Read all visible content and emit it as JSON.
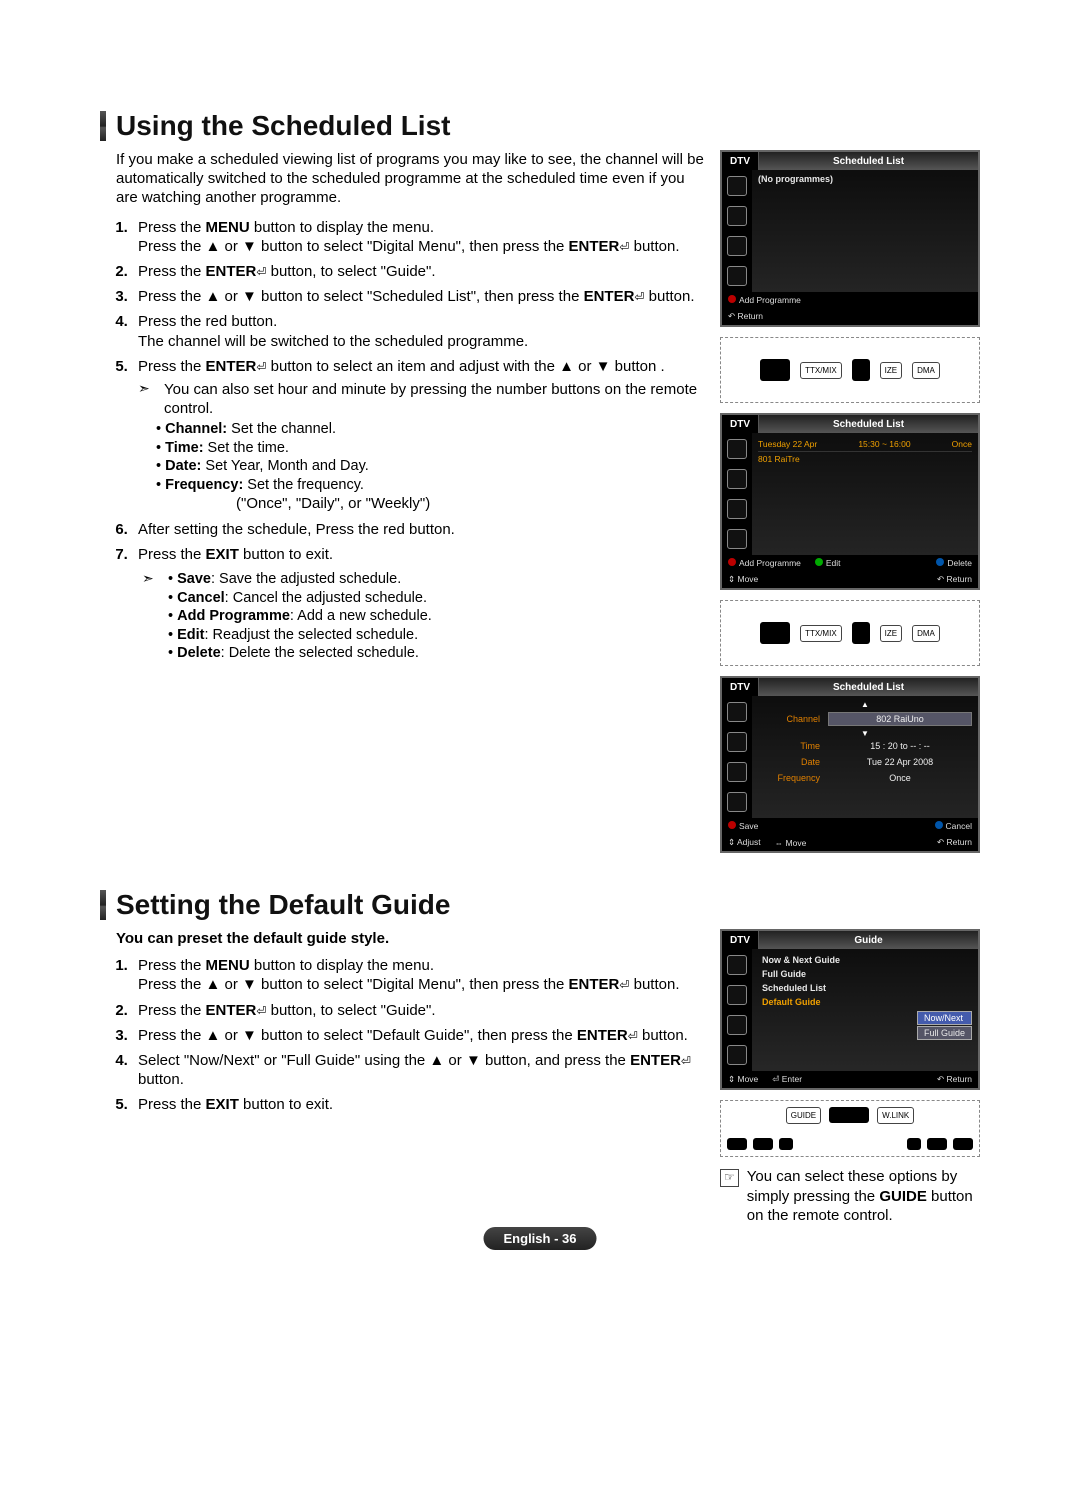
{
  "section1": {
    "title": "Using the Scheduled List",
    "intro": "If you make a scheduled viewing list of programs you may like to see, the channel will be automatically switched to the scheduled programme at the scheduled time even if you are watching another programme.",
    "steps": {
      "s1a": "Press the ",
      "s1_menu": "MENU",
      "s1b": " button to display the menu.",
      "s1c": "Press the ▲ or ▼ button to select \"Digital Menu\", then press the ",
      "s1_enter": "ENTER",
      "s1d": " button.",
      "s2a": "Press the ",
      "s2_enter": "ENTER",
      "s2b": " button, to select \"Guide\".",
      "s3a": "Press the ▲ or ▼ button to select \"Scheduled List\", then press the ",
      "s3_enter": "ENTER",
      "s3b": " button.",
      "s4a": "Press the red button.",
      "s4b": "The channel will be switched to the scheduled programme.",
      "s5a": "Press the ",
      "s5_enter": "ENTER",
      "s5b": " button to select an item and adjust with the ▲ or ▼ button .",
      "s5_note": "You can also set hour and minute by pressing the number buttons on the remote control.",
      "s5_ch_l": "Channel:",
      "s5_ch_t": " Set the channel.",
      "s5_tm_l": "Time:",
      "s5_tm_t": " Set the time.",
      "s5_dt_l": "Date:",
      "s5_dt_t": " Set Year, Month and Day.",
      "s5_fq_l": "Frequency:",
      "s5_fq_t": " Set the frequency.",
      "s5_fq_opts": "(\"Once\", \"Daily\", or \"Weekly\")",
      "s6": "After setting the schedule, Press the red button.",
      "s7a": "Press the ",
      "s7_exit": "EXIT",
      "s7b": " button to exit.",
      "fn_sv_l": "Save",
      "fn_sv_t": ": Save the adjusted schedule.",
      "fn_cn_l": "Cancel",
      "fn_cn_t": ": Cancel the adjusted schedule.",
      "fn_ap_l": "Add Programme",
      "fn_ap_t": ": Add a new schedule.",
      "fn_ed_l": "Edit",
      "fn_ed_t": ": Readjust the selected schedule.",
      "fn_dl_l": "Delete",
      "fn_dl_t": ": Delete the selected schedule."
    }
  },
  "osd": {
    "dtv": "DTV",
    "title": "Scheduled List",
    "no_prog": "(No programmes)",
    "add_prog": "Add Programme",
    "return": "Return",
    "edit": "Edit",
    "delete": "Delete",
    "move": "Move",
    "adjust": "Adjust",
    "row_day": "Tuesday  22  Apr",
    "row_time": "15:30 ~ 16:00",
    "row_once": "Once",
    "row_ch": "801  RaiTre",
    "det_channel_l": "Channel",
    "det_channel_v": "802 RaiUno",
    "det_time_l": "Time",
    "det_time_v": "15 : 20 to -- : --",
    "det_date_l": "Date",
    "det_date_v": "Tue 22 Apr 2008",
    "det_freq_l": "Frequency",
    "det_freq_v": "Once",
    "save": "Save",
    "cancel": "Cancel",
    "enter": "Enter"
  },
  "remote": {
    "ttx": "TTX/MIX",
    "ize": "IZE",
    "dma": "DMA",
    "guide": "GUIDE",
    "wlink": "W.LINK"
  },
  "section2": {
    "title": "Setting the Default Guide",
    "preface": "You can preset the default guide style.",
    "steps": {
      "s1a": "Press the ",
      "s1_menu": "MENU",
      "s1b": " button to display the menu.",
      "s1c": "Press the ▲ or ▼ button to select \"Digital Menu\", then press the ",
      "s1_enter": "ENTER",
      "s1d": " button.",
      "s2a": "Press the ",
      "s2_enter": "ENTER",
      "s2b": " button, to select \"Guide\".",
      "s3a": "Press the ▲ or ▼ button to select \"Default Guide\", then press the ",
      "s3_enter": "ENTER",
      "s3b": " button.",
      "s4": "Select \"Now/Next\" or \"Full Guide\" using the ▲ or ▼ button, and press the ",
      "s4_enter": "ENTER",
      "s4b": " button.",
      "s5a": "Press the ",
      "s5_exit": "EXIT",
      "s5b": " button to exit."
    },
    "note": "You can select these options by simply pressing the ",
    "note_guide": "GUIDE",
    "note2": " button on the remote control."
  },
  "guide_osd": {
    "title": "Guide",
    "item1": "Now & Next Guide",
    "item2": "Full Guide",
    "item3": "Scheduled List",
    "item4": "Default Guide",
    "opt1": "Now/Next",
    "opt2": "Full Guide"
  },
  "footer": "English - 36"
}
